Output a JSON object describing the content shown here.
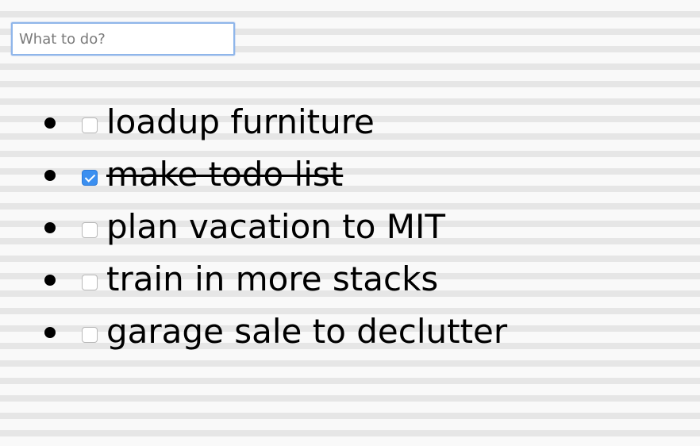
{
  "input": {
    "placeholder": "What to do?",
    "value": ""
  },
  "todos": [
    {
      "text": "loadup furniture",
      "done": false
    },
    {
      "text": "make todo list",
      "done": true
    },
    {
      "text": "plan vacation to MIT",
      "done": false
    },
    {
      "text": "train in more stacks",
      "done": false
    },
    {
      "text": "garage sale to declutter",
      "done": false
    }
  ],
  "colors": {
    "checkbox_checked": "#3b8ff0",
    "input_focus_border": "#8fb6ea",
    "paper_line": "#e6e6e6",
    "paper_background": "#f9f9f9"
  },
  "icons": {
    "bullet": "bullet-icon",
    "checkbox": "checkbox"
  }
}
